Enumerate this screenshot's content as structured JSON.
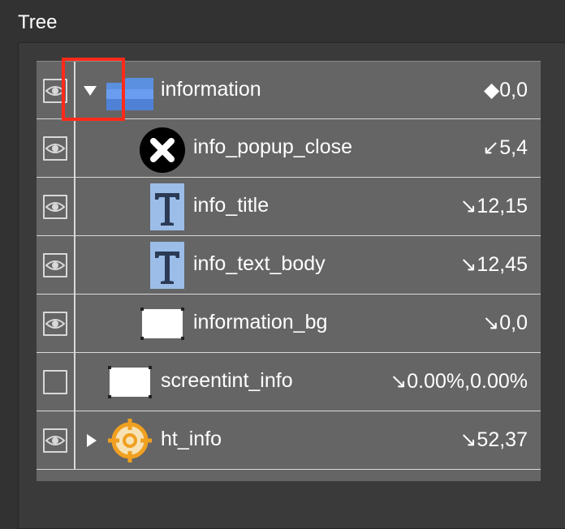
{
  "panel": {
    "title": "Tree"
  },
  "tree": {
    "rows": [
      {
        "name": "information",
        "value": "◆0,0",
        "visible": true,
        "icon": "folder-icon",
        "expander": "expanded"
      },
      {
        "name": "info_popup_close",
        "value": "↙5,4",
        "visible": true,
        "icon": "close-circle-icon",
        "expander": "none"
      },
      {
        "name": "info_title",
        "value": "↘12,15",
        "visible": true,
        "icon": "text-icon",
        "expander": "none"
      },
      {
        "name": "info_text_body",
        "value": "↘12,45",
        "visible": true,
        "icon": "text-icon",
        "expander": "none"
      },
      {
        "name": "information_bg",
        "value": "↘0,0",
        "visible": true,
        "icon": "image-rect-icon",
        "expander": "none"
      },
      {
        "name": "screentint_info",
        "value": "↘0.00%,0.00%",
        "visible": false,
        "icon": "image-rect-icon",
        "expander": "none"
      },
      {
        "name": "ht_info",
        "value": "↘52,37",
        "visible": true,
        "icon": "hotspot-target-icon",
        "expander": "collapsed"
      }
    ]
  },
  "colors": {
    "background": "#323232",
    "row": "#656565",
    "separator": "#d8d8d8",
    "highlight": "#ff2a1a",
    "folder": "#5b8fe0",
    "text_icon_bg": "#9bbde8",
    "hotspot": "#f0a020"
  }
}
